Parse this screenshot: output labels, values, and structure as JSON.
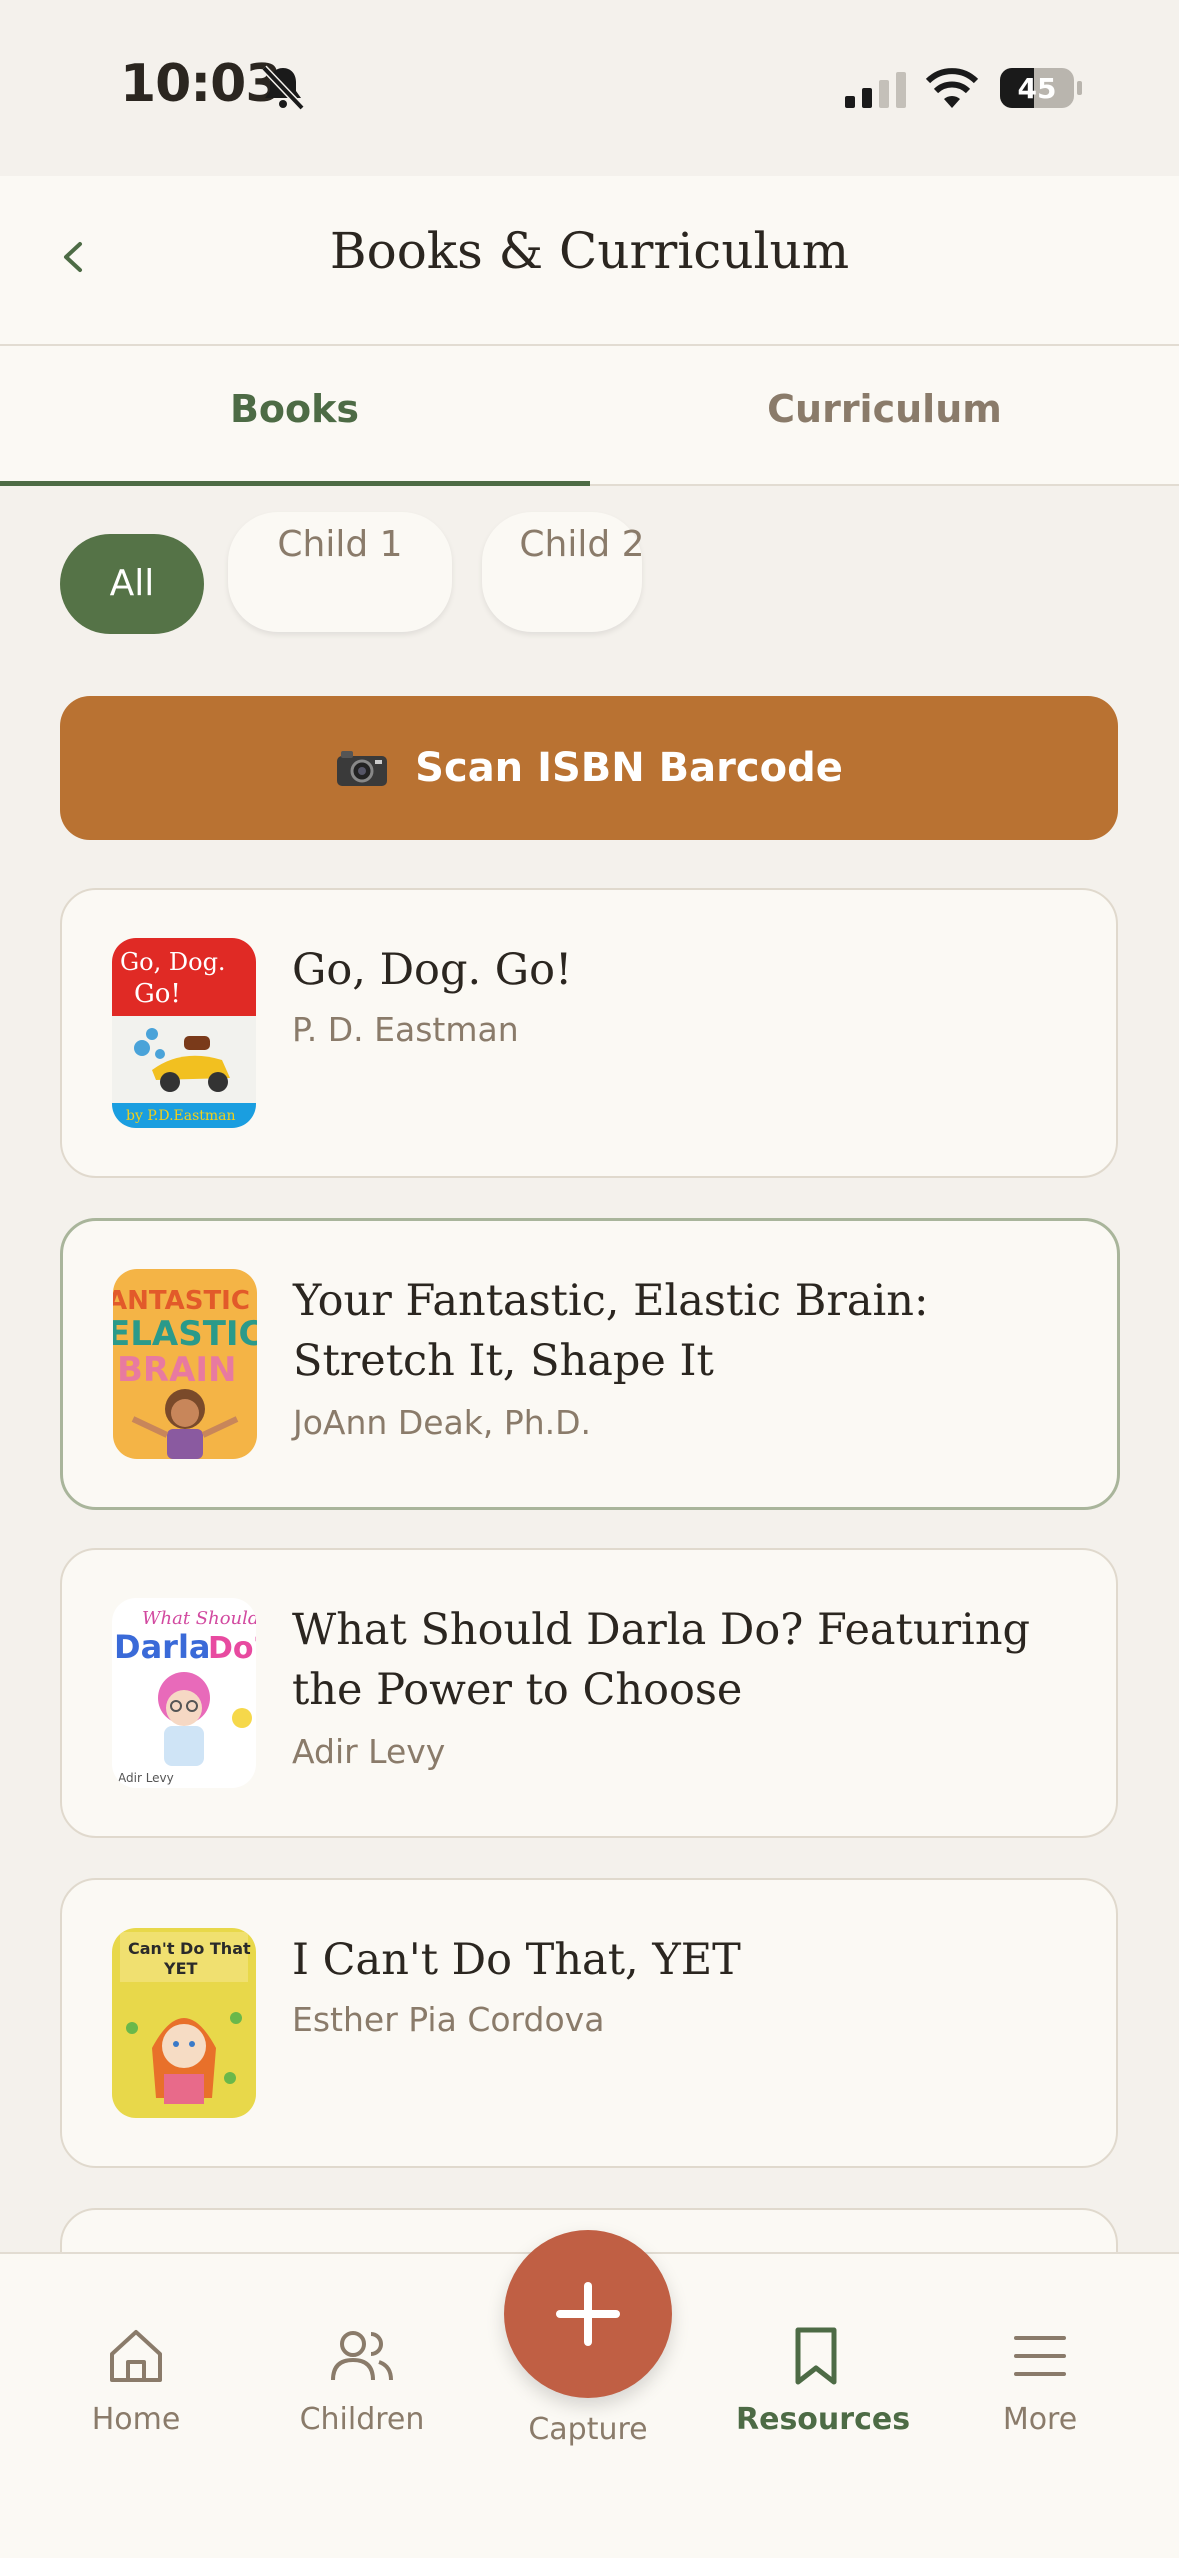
{
  "status_bar": {
    "time": "10:03",
    "battery": "45"
  },
  "header": {
    "title": "Books & Curriculum",
    "back_icon": "chevron-left-icon"
  },
  "tabs": [
    {
      "label": "Books",
      "active": true
    },
    {
      "label": "Curriculum",
      "active": false
    }
  ],
  "filters": [
    {
      "label": "All",
      "active": true
    },
    {
      "label": "Child 1",
      "active": false
    },
    {
      "label": "Child 2",
      "active": false
    }
  ],
  "scan_button": {
    "label": "Scan ISBN Barcode",
    "icon": "camera-icon"
  },
  "books": [
    {
      "title": "Go, Dog. Go!",
      "author": "P. D. Eastman"
    },
    {
      "title": "Your Fantastic, Elastic Brain: Stretch It, Shape It",
      "author": "JoAnn Deak, Ph.D."
    },
    {
      "title": "What Should Darla Do? Featuring the Power to Choose",
      "author": "Adir Levy"
    },
    {
      "title": "I Can't Do That, YET",
      "author": "Esther Pia Cordova"
    }
  ],
  "bottom_nav": {
    "items": [
      {
        "label": "Home",
        "icon": "home-icon"
      },
      {
        "label": "Children",
        "icon": "users-icon"
      },
      {
        "label": "Capture",
        "icon": "plus-icon"
      },
      {
        "label": "Resources",
        "icon": "bookmark-icon",
        "active": true
      },
      {
        "label": "More",
        "icon": "menu-icon"
      }
    ]
  },
  "colors": {
    "accent_green": "#4d6b45",
    "scan_orange": "#b97232",
    "capture_red": "#c05f44",
    "background": "#f4f1ec"
  }
}
